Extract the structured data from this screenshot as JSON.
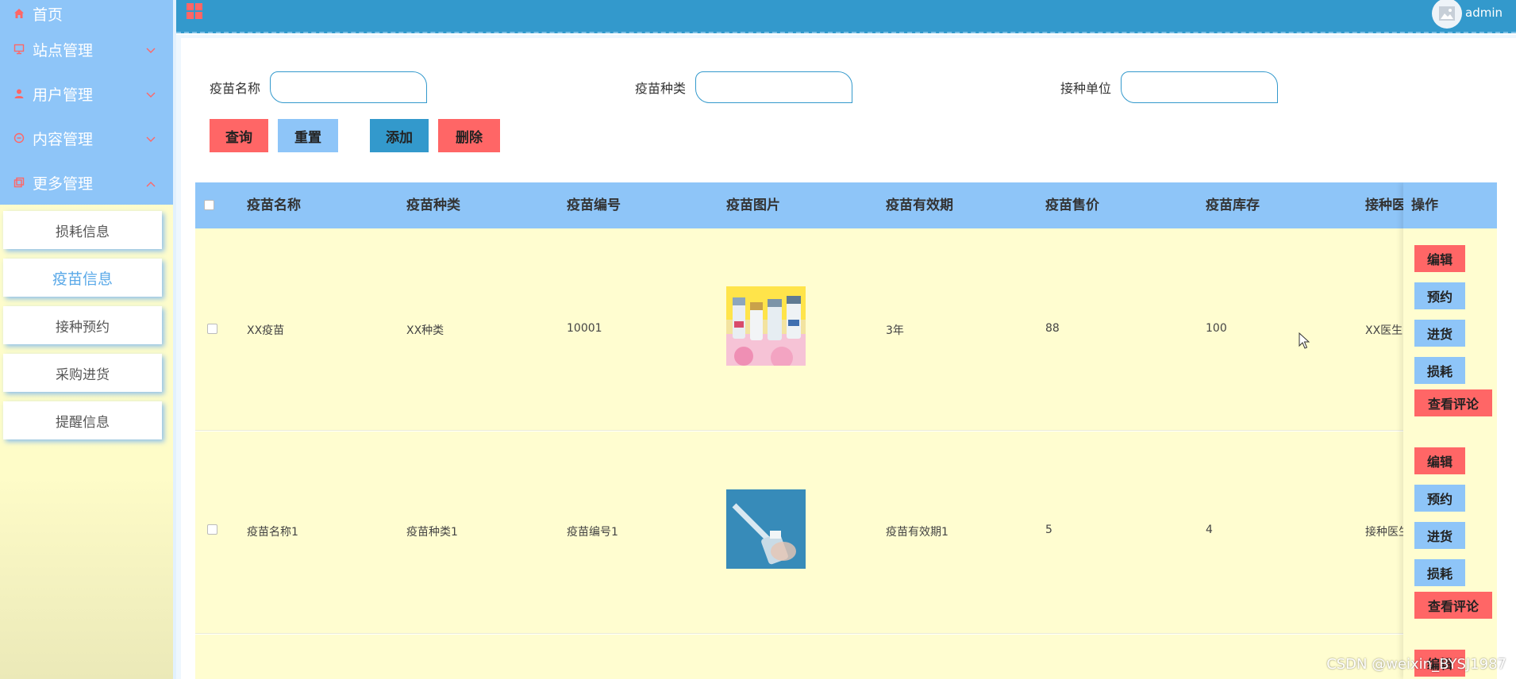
{
  "sidebar": {
    "home": "首页",
    "menus": [
      {
        "label": "站点管理",
        "expanded": false
      },
      {
        "label": "用户管理",
        "expanded": false
      },
      {
        "label": "内容管理",
        "expanded": false
      },
      {
        "label": "更多管理",
        "expanded": true
      }
    ],
    "sub_items": [
      {
        "label": "损耗信息",
        "active": false
      },
      {
        "label": "疫苗信息",
        "active": true
      },
      {
        "label": "接种预约",
        "active": false
      },
      {
        "label": "采购进货",
        "active": false
      },
      {
        "label": "提醒信息",
        "active": false
      }
    ]
  },
  "topbar": {
    "username": "admin"
  },
  "search": {
    "fields": [
      {
        "label": "疫苗名称",
        "value": ""
      },
      {
        "label": "疫苗种类",
        "value": ""
      },
      {
        "label": "接种单位",
        "value": ""
      }
    ]
  },
  "buttons": {
    "query": "查询",
    "reset": "重置",
    "add": "添加",
    "delete": "删除"
  },
  "table": {
    "headers": [
      "疫苗名称",
      "疫苗种类",
      "疫苗编号",
      "疫苗图片",
      "疫苗有效期",
      "疫苗售价",
      "疫苗库存",
      "接种医"
    ],
    "ops_header": "操作",
    "rows": [
      {
        "name": "XX疫苗",
        "type": "XX种类",
        "code": "10001",
        "validity": "3年",
        "price": "88",
        "stock": "100",
        "doctor": "XX医生"
      },
      {
        "name": "疫苗名称1",
        "type": "疫苗种类1",
        "code": "疫苗编号1",
        "validity": "疫苗有效期1",
        "price": "5",
        "stock": "4",
        "doctor": "接种医生"
      }
    ],
    "ops": {
      "edit": "编辑",
      "reserve": "预约",
      "stockin": "进货",
      "loss": "损耗",
      "comments": "查看评论"
    }
  },
  "colors": {
    "primary": "#3399cc",
    "light": "#8ec5f8",
    "danger": "#ff6666",
    "row_bg": "#fffdd0"
  },
  "watermark": "CSDN @weixin_BYSJ1987"
}
